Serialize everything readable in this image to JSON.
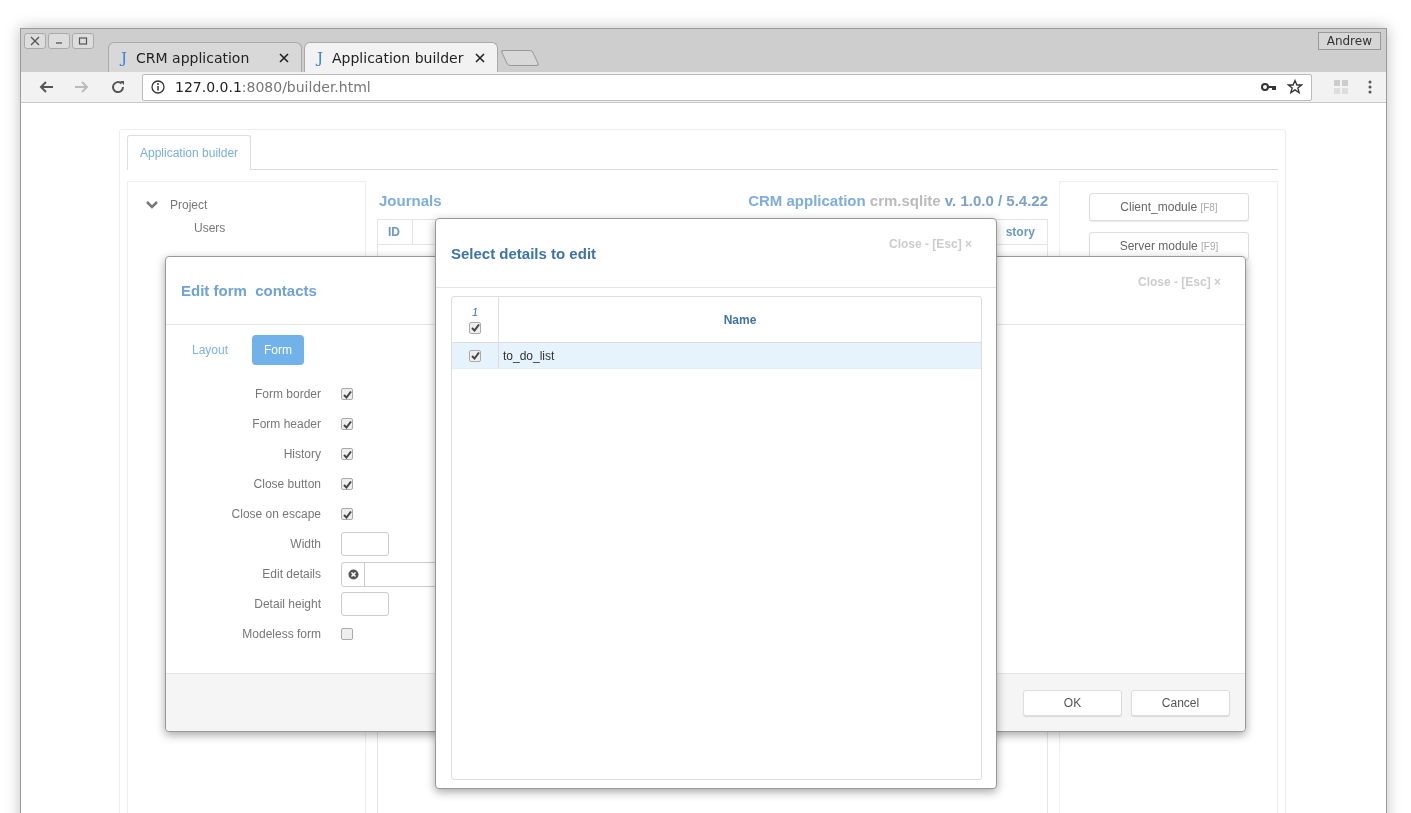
{
  "browser": {
    "tabs": [
      {
        "icon": "J",
        "title": "CRM application",
        "selected": false
      },
      {
        "icon": "J",
        "title": "Application builder",
        "selected": true
      }
    ],
    "profile": "Andrew",
    "url": {
      "host": "127.0.0.1",
      "rest": ":8080/builder.html"
    }
  },
  "app": {
    "tabs": [
      {
        "label": "Application builder",
        "selected": true
      }
    ],
    "tree": [
      {
        "label": "Project",
        "expanded": true,
        "children": [
          {
            "label": "Users"
          }
        ]
      }
    ],
    "journals": {
      "title": "Journals",
      "project": {
        "name": "CRM application",
        "db": "crm.sqlite",
        "version": "v. 1.0.0 / 5.4.22"
      },
      "columns": [
        "ID",
        "story"
      ]
    },
    "modules": [
      {
        "label": "Client_module",
        "shortcut": "[F8]"
      },
      {
        "label": "Server module",
        "shortcut": "[F9]"
      }
    ]
  },
  "edit_form": {
    "title": "Edit form",
    "name": "contacts",
    "close": "Close - [Esc] ×",
    "tabs": [
      {
        "label": "Layout",
        "selected": false
      },
      {
        "label": "Form",
        "selected": true
      }
    ],
    "fields": [
      {
        "kind": "checkbox",
        "label": "Form border",
        "checked": true
      },
      {
        "kind": "checkbox",
        "label": "Form header",
        "checked": true
      },
      {
        "kind": "checkbox",
        "label": "History",
        "checked": true
      },
      {
        "kind": "checkbox",
        "label": "Close button",
        "checked": true
      },
      {
        "kind": "checkbox",
        "label": "Close on escape",
        "checked": true
      },
      {
        "kind": "text",
        "label": "Width"
      },
      {
        "kind": "lookup",
        "label": "Edit details"
      },
      {
        "kind": "text",
        "label": "Detail height"
      },
      {
        "kind": "checkbox",
        "label": "Modeless form",
        "checked": false
      }
    ],
    "buttons": [
      "OK",
      "Cancel"
    ]
  },
  "select_dialog": {
    "title": "Select details to edit",
    "close": "Close - [Esc] ×",
    "table": {
      "count": "1",
      "all_checked": true,
      "columns": [
        "Name"
      ],
      "rows": [
        {
          "name": "to_do_list",
          "checked": true,
          "selected": true
        }
      ]
    }
  }
}
